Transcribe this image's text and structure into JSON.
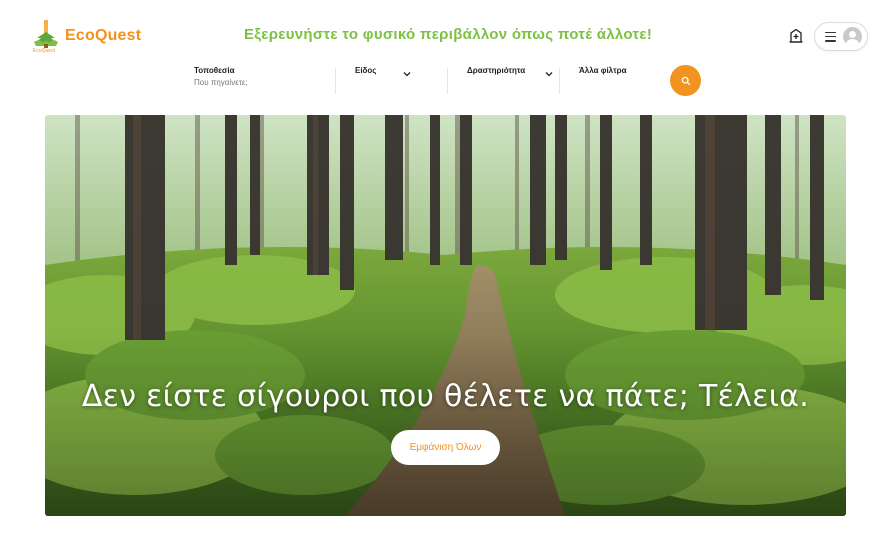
{
  "brand": {
    "name": "EcoQuest",
    "sub": "EcoQuest",
    "color_primary": "#f2921f",
    "color_green": "#7cc142"
  },
  "header": {
    "tagline": "Εξερευνήστε το φυσικό περιβάλλον όπως ποτέ άλλοτε!",
    "host_icon": "building-plus-icon",
    "menu_icon": "menu-icon",
    "avatar_icon": "user-avatar-icon"
  },
  "search": {
    "location_label": "Τοποθεσία",
    "location_placeholder": "Που πηγαίνετε;",
    "type_label": "Είδος",
    "activity_label": "Δραστηριότητα",
    "filters_label": "Άλλα φίλτρα",
    "search_icon": "search-icon"
  },
  "hero": {
    "title": "Δεν είστε σίγουροι που θέλετε να πάτε; Τέλεια.",
    "button_label": "Εμφάνιση Όλων",
    "image": "forest-path-photo"
  }
}
